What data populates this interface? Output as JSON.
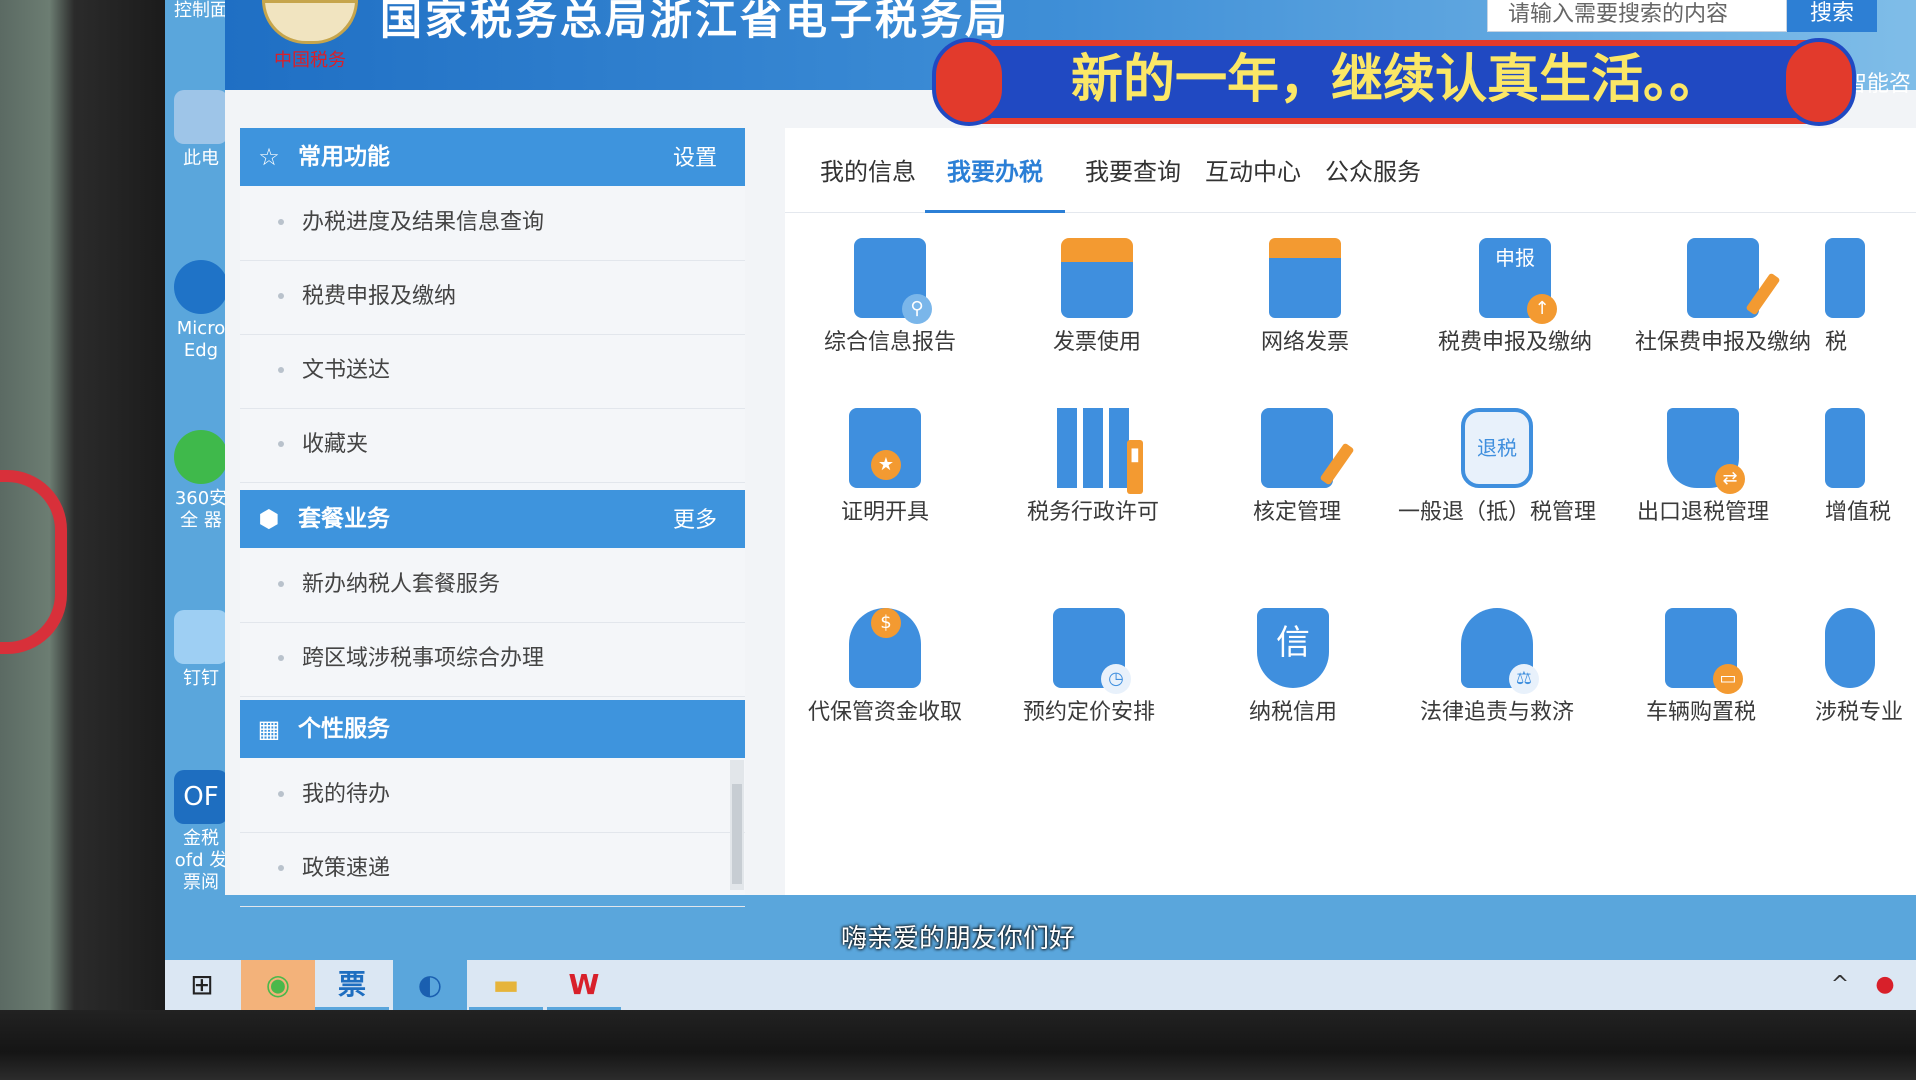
{
  "site": {
    "title": "国家税务总局浙江省电子税务局",
    "motto": "中国税务",
    "search_placeholder": "请输入需要搜索的内容",
    "search_label": "搜索",
    "smart_consult": "智能咨"
  },
  "desktop": [
    {
      "label": "控制面",
      "icon": "control-panel-icon"
    },
    {
      "label": "此电",
      "icon": "this-pc-icon"
    },
    {
      "label": "Micro Edg",
      "icon": "edge-icon"
    },
    {
      "label": "360安全 器",
      "icon": "360-browser-icon"
    },
    {
      "label": "钉钉",
      "icon": "dingtalk-icon"
    },
    {
      "label": "金税ofd 发票阅",
      "icon": "ofd-reader-icon"
    }
  ],
  "sidebar": {
    "common": {
      "title": "常用功能",
      "action": "设置",
      "icon": "star-icon",
      "items": [
        "办税进度及结果信息查询",
        "税费申报及缴纳",
        "文书送达",
        "收藏夹"
      ]
    },
    "package": {
      "title": "套餐业务",
      "action": "更多",
      "icon": "cube-icon",
      "items": [
        "新办纳税人套餐服务",
        "跨区域涉税事项综合办理"
      ]
    },
    "personal": {
      "title": "个性服务",
      "icon": "grid-icon",
      "items": [
        "我的待办",
        "政策速递"
      ]
    }
  },
  "tabs": [
    "我的信息",
    "我要办税",
    "我要查询",
    "互动中心",
    "公众服务"
  ],
  "active_tab": "我要办税",
  "services": [
    "综合信息报告",
    "发票使用",
    "网络发票",
    "税费申报及缴纳",
    "社保费申报及缴纳",
    "税",
    "证明开具",
    "税务行政许可",
    "核定管理",
    "一般退（抵）税管理",
    "出口退税管理",
    "增值税",
    "代保管资金收取",
    "预约定价安排",
    "纳税信用",
    "法律追责与救济",
    "车辆购置税",
    "涉税专业"
  ],
  "icon_labels": {
    "apply": "申报",
    "refund": "退税",
    "credit": "信"
  },
  "overlay": {
    "banner": "新的一年，继续认真生活。。",
    "subtitle": "嗨亲爱的朋友你们好"
  },
  "taskbar": [
    "windows-start-icon",
    "wechat-icon",
    "tax-invoice-icon",
    "edge-icon",
    "file-explorer-icon",
    "wps-icon"
  ],
  "colors": {
    "accent": "#3e94dd",
    "active_tab": "#2b7fd6",
    "icon_orange": "#f39a31",
    "banner_red": "#e23a2c",
    "banner_blue": "#2049c2",
    "banner_text": "#fbe766"
  }
}
